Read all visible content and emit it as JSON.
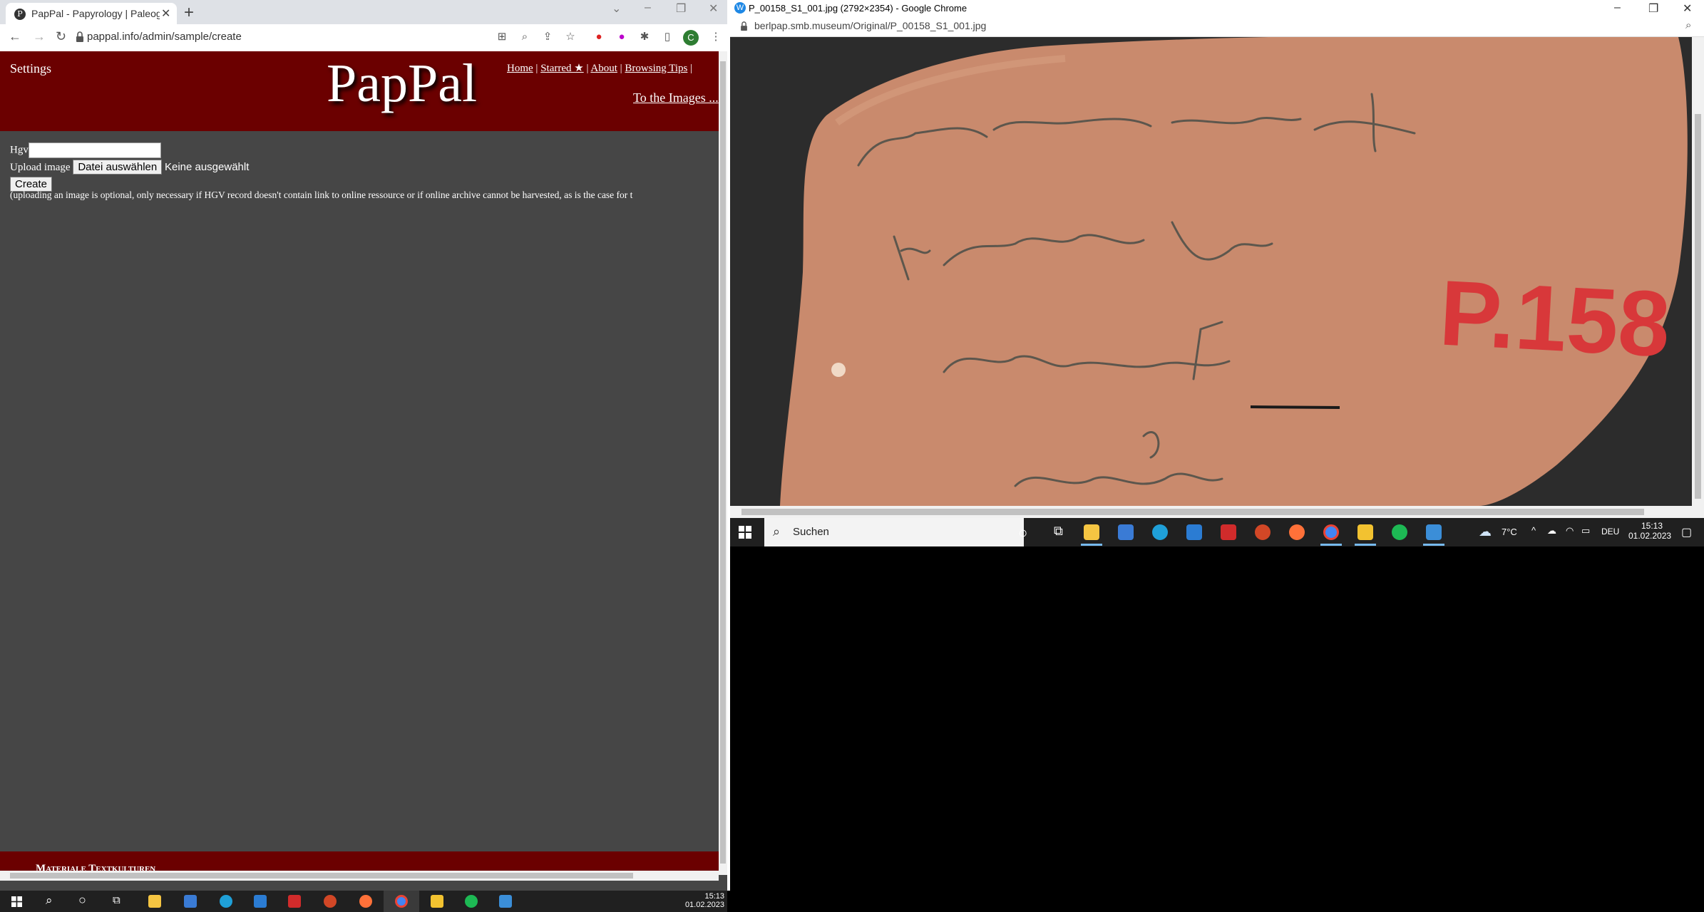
{
  "left_browser": {
    "tab_title": "PapPal - Papyrology | Paleography",
    "url": "pappal.info/admin/sample/create",
    "avatar_letter": "C"
  },
  "site": {
    "settings_label": "Settings",
    "logo": "PapPal",
    "nav": [
      "Home",
      "Starred ★",
      "About",
      "Browsing Tips"
    ],
    "nav_sep": "|",
    "to_images": "To the Images ...",
    "footer": "Materiale Textkulturen"
  },
  "form": {
    "hgv_label": "Hgv",
    "hgv_value": "",
    "upload_label": "Upload image",
    "choose_file": "Datei auswählen",
    "no_file": "Keine ausgewählt",
    "create": "Create",
    "note": "(uploading an image is optional, only necessary if HGV record doesn't contain link to online ressource or if online archive cannot be harvested, as is the case for t"
  },
  "right_browser": {
    "title": "P_00158_S1_001.jpg (2792×2354) - Google Chrome",
    "url": "berlpap.smb.museum/Original/P_00158_S1_001.jpg",
    "image_label": "P.158"
  },
  "taskbar_right": {
    "search_placeholder": "Suchen",
    "weather": "7°C",
    "lang": "DEU",
    "time": "15:13",
    "date": "01.02.2023"
  },
  "taskbar_bottom": {
    "time": "15:13",
    "date": "01.02.2023"
  },
  "colors": {
    "header_red": "#6b0000",
    "page_bg": "#464646",
    "ostracon": "#c98a6d"
  }
}
